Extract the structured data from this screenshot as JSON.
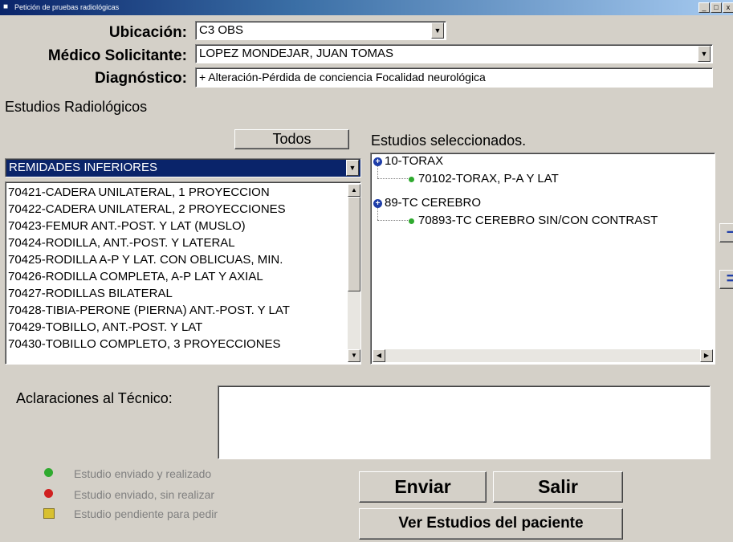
{
  "window": {
    "title": "Petición de pruebas radiológicas",
    "controls": [
      "_",
      "□",
      "x"
    ]
  },
  "form": {
    "ubicacion_label": "Ubicación:",
    "ubicacion_value": "C3 OBS",
    "medico_label": "Médico Solicitante:",
    "medico_value": "LOPEZ MONDEJAR, JUAN TOMAS",
    "diagnostico_label": "Diagnóstico:",
    "diagnostico_value": "+ Alteración-Pérdida de conciencia Focalidad neurológica"
  },
  "estudios": {
    "section_label": "Estudios Radiológicos",
    "todos_label": "Todos",
    "category_value": "REMIDADES INFERIORES",
    "items": [
      "70421-CADERA UNILATERAL, 1 PROYECCION",
      "70422-CADERA UNILATERAL, 2 PROYECCIONES",
      "70423-FEMUR ANT.-POST. Y LAT (MUSLO)",
      "70424-RODILLA, ANT.-POST. Y LATERAL",
      "70425-RODILLA A-P Y LAT. CON OBLICUAS, MIN.",
      "70426-RODILLA COMPLETA, A-P LAT Y AXIAL",
      "70427-RODILLAS BILATERAL",
      "70428-TIBIA-PERONE (PIERNA) ANT.-POST. Y LAT",
      "70429-TOBILLO, ANT.-POST. Y LAT",
      "70430-TOBILLO COMPLETO, 3 PROYECCIONES"
    ]
  },
  "seleccionados": {
    "section_label": "Estudios seleccionados.",
    "groups": [
      {
        "label": "10-TORAX",
        "child": "70102-TORAX, P-A Y LAT"
      },
      {
        "label": "89-TC CEREBRO",
        "child": "70893-TC CEREBRO SIN/CON CONTRAST"
      }
    ]
  },
  "aclaraciones": {
    "label": "Aclaraciones al Técnico:",
    "value": ""
  },
  "legend": {
    "realizado": "Estudio enviado y realizado",
    "sin_realizar": "Estudio enviado, sin realizar",
    "pendiente": "Estudio pendiente para pedir",
    "colors": {
      "realizado": "#2faa2f",
      "sin_realizar": "#d02020",
      "pendiente": "#d8c030"
    }
  },
  "buttons": {
    "enviar": "Enviar",
    "salir": "Salir",
    "ver_estudios": "Ver Estudios del paciente"
  },
  "side_buttons": {
    "minus": "–",
    "equals": "="
  },
  "icons": {
    "dropdown": "chevron-down-icon",
    "tree_expand": "plus-circle-icon",
    "tree_leaf": "green-dot-icon"
  }
}
